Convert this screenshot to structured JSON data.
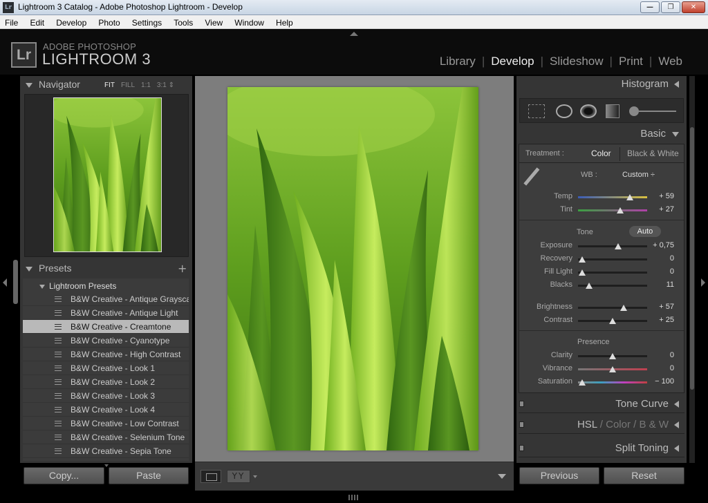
{
  "window": {
    "title": "Lightroom 3 Catalog - Adobe Photoshop Lightroom - Develop",
    "min": "—",
    "max": "❐",
    "close": "✕"
  },
  "menu": [
    "File",
    "Edit",
    "Develop",
    "Photo",
    "Settings",
    "Tools",
    "View",
    "Window",
    "Help"
  ],
  "brand": {
    "logo": "Lr",
    "sub": "ADOBE PHOTOSHOP",
    "main": "LIGHTROOM 3"
  },
  "modules": [
    "Library",
    "Develop",
    "Slideshow",
    "Print",
    "Web"
  ],
  "active_module": "Develop",
  "navigator": {
    "title": "Navigator",
    "zoom": [
      "FIT",
      "FILL",
      "1:1",
      "3:1 ⇕"
    ],
    "selected_zoom": "FIT"
  },
  "presets": {
    "title": "Presets",
    "add": "+",
    "folder": "Lightroom Presets",
    "items": [
      "B&W Creative - Antique Grayscale",
      "B&W Creative - Antique Light",
      "B&W Creative - Creamtone",
      "B&W Creative - Cyanotype",
      "B&W Creative - High Contrast",
      "B&W Creative - Look 1",
      "B&W Creative - Look 2",
      "B&W Creative - Look 3",
      "B&W Creative - Look 4",
      "B&W Creative - Low Contrast",
      "B&W Creative - Selenium Tone",
      "B&W Creative - Sepia Tone"
    ],
    "selected": "B&W Creative - Creamtone"
  },
  "left_buttons": {
    "copy": "Copy...",
    "paste": "Paste"
  },
  "toolbar": {
    "yy": "YY"
  },
  "right": {
    "histogram": "Histogram",
    "basic": "Basic",
    "treatment": {
      "label": "Treatment :",
      "color": "Color",
      "bw": "Black & White"
    },
    "wb": {
      "label": "WB :",
      "value": "Custom ÷"
    },
    "sliders": [
      {
        "label": "Temp",
        "value": "+ 59",
        "pos": 0.75
      },
      {
        "label": "Tint",
        "value": "+ 27",
        "pos": 0.61
      },
      {
        "label": "Exposure",
        "value": "+ 0,75",
        "pos": 0.58
      },
      {
        "label": "Recovery",
        "value": "0",
        "pos": 0.06
      },
      {
        "label": "Fill Light",
        "value": "0",
        "pos": 0.06
      },
      {
        "label": "Blacks",
        "value": "11",
        "pos": 0.16
      },
      {
        "label": "Brightness",
        "value": "+ 57",
        "pos": 0.66
      },
      {
        "label": "Contrast",
        "value": "+ 25",
        "pos": 0.5
      },
      {
        "label": "Clarity",
        "value": "0",
        "pos": 0.5
      },
      {
        "label": "Vibrance",
        "value": "0",
        "pos": 0.5
      },
      {
        "label": "Saturation",
        "value": "− 100",
        "pos": 0.06
      }
    ],
    "tone": "Tone",
    "auto": "Auto",
    "presence": "Presence",
    "tone_curve": "Tone Curve",
    "hsl": {
      "a": "HSL",
      "sep": "/",
      "b": "Color",
      "c": "B & W"
    },
    "split_toning": "Split Toning",
    "previous": "Previous",
    "reset": "Reset"
  },
  "colors": {
    "accent": "#b9b9b9",
    "panel": "#353535",
    "workspace": "#7d7d7d"
  }
}
